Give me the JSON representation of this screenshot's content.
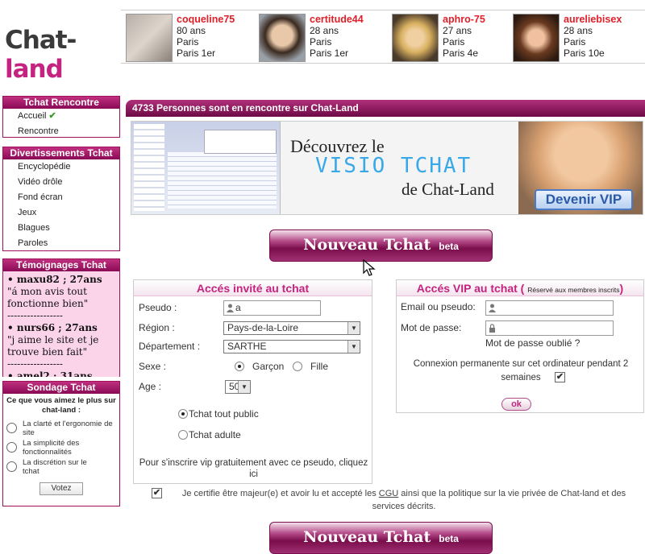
{
  "logo": {
    "part1": "Chat-",
    "part2": "land"
  },
  "profiles": [
    {
      "nick": "coqueline75",
      "age": "80 ans",
      "city": "Paris",
      "district": "Paris 1er"
    },
    {
      "nick": "certitude44",
      "age": "28 ans",
      "city": "Paris",
      "district": "Paris 1er"
    },
    {
      "nick": "aphro-75",
      "age": "27 ans",
      "city": "Paris",
      "district": "Paris 4e"
    },
    {
      "nick": "aureliebisex",
      "age": "28 ans",
      "city": "Paris",
      "district": "Paris 10e"
    }
  ],
  "sidebar": {
    "rencontre": {
      "title": "Tchat Rencontre",
      "items": [
        "Accueil",
        "Rencontre"
      ]
    },
    "divertissements": {
      "title": "Divertissements Tchat",
      "items": [
        "Encyclopédie",
        "Vidéo drôle",
        "Fond écran",
        "Jeux",
        "Blagues",
        "Paroles"
      ]
    },
    "temoignages": {
      "title": "Témoignages Tchat",
      "entries": [
        {
          "author": "• maxu82 ; 27ans",
          "quote": "\"á mon avis tout fonctionne bien\""
        },
        {
          "author": "• nurs66 ; 27ans",
          "quote": "\"j aime le site et je trouve bien fait\""
        },
        {
          "author": "• amel2 ; 31ans",
          "quote": ""
        }
      ],
      "separator": "-----------------"
    },
    "sondage": {
      "title": "Sondage Tchat",
      "question": "Ce que vous aimez le plus sur chat-land :",
      "options": [
        "La clarté et l'ergonomie de site",
        "La simplicité des fonctionnalités",
        "La discrétion sur le tchat"
      ],
      "vote_label": "Votez"
    }
  },
  "main": {
    "banner_bar": "4733 Personnes sont en rencontre sur Chat-Land",
    "banner": {
      "line1": "Découvrez le",
      "line2": "VISIO TCHAT",
      "line3": "de Chat-Land",
      "cta": "Devenir VIP"
    },
    "new_chat_button": "Nouveau Tchat",
    "beta_label": "beta"
  },
  "guest": {
    "title": "Accés invité au tchat",
    "pseudo_label": "Pseudo :",
    "pseudo_value": "a",
    "region_label": "Région :",
    "region_value": "Pays-de-la-Loire",
    "dept_label": "Département :",
    "dept_value": "SARTHE",
    "sexe_label": "Sexe :",
    "sexe_options": [
      "Garçon",
      "Fille"
    ],
    "age_label": "Age :",
    "age_value": "50",
    "mode_options": [
      "Tchat tout public",
      "Tchat adulte"
    ],
    "vip_note": "Pour s'inscrire vip gratuitement avec ce pseudo, cliquez ici"
  },
  "vip": {
    "title": "Accés VIP au tchat (",
    "title_note": "Réservé aux membres inscrits",
    "title_end": ")",
    "email_label": "Email ou pseudo:",
    "password_label": "Mot de passe:",
    "forgot": "Mot de passe oublié ?",
    "remember": "Connexion permanente sur cet ordinateur pendant 2 semaines",
    "ok": "ok"
  },
  "certify": {
    "text_before": "Je certifie être majeur(e) et avoir lu et accepté les ",
    "cgu": "CGU",
    "text_after": " ainsi que la politique sur la vie privée de Chat-land et des services décrits."
  },
  "colors": {
    "brand": "#c4237f",
    "dark_brand": "#7a0d4c",
    "nick": "#e0202a",
    "testimonial_bg": "#fbd4ea"
  }
}
